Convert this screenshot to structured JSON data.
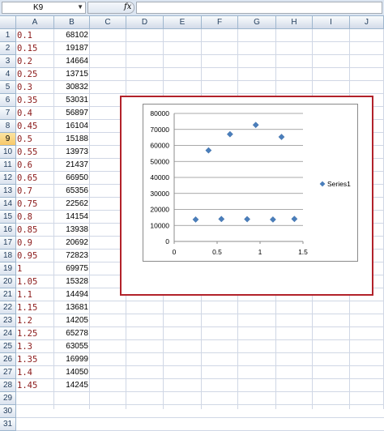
{
  "formula_bar": {
    "name_box": "K9",
    "fx_label": "fx",
    "formula": ""
  },
  "columns": [
    "A",
    "B",
    "C",
    "D",
    "E",
    "F",
    "G",
    "H",
    "I",
    "J"
  ],
  "active_row": 9,
  "rows": [
    {
      "num": "1",
      "a": "0.1",
      "b": "68102"
    },
    {
      "num": "2",
      "a": "0.15",
      "b": "19187"
    },
    {
      "num": "3",
      "a": "0.2",
      "b": "14664"
    },
    {
      "num": "4",
      "a": "0.25",
      "b": "13715"
    },
    {
      "num": "5",
      "a": "0.3",
      "b": "30832"
    },
    {
      "num": "6",
      "a": "0.35",
      "b": "53031"
    },
    {
      "num": "7",
      "a": "0.4",
      "b": "56897"
    },
    {
      "num": "8",
      "a": "0.45",
      "b": "16104"
    },
    {
      "num": "9",
      "a": "0.5",
      "b": "15188"
    },
    {
      "num": "10",
      "a": "0.55",
      "b": "13973"
    },
    {
      "num": "11",
      "a": "0.6",
      "b": "21437"
    },
    {
      "num": "12",
      "a": "0.65",
      "b": "66950"
    },
    {
      "num": "13",
      "a": "0.7",
      "b": "65356"
    },
    {
      "num": "14",
      "a": "0.75",
      "b": "22562"
    },
    {
      "num": "15",
      "a": "0.8",
      "b": "14154"
    },
    {
      "num": "16",
      "a": "0.85",
      "b": "13938"
    },
    {
      "num": "17",
      "a": "0.9",
      "b": "20692"
    },
    {
      "num": "18",
      "a": "0.95",
      "b": "72823"
    },
    {
      "num": "19",
      "a": "1",
      "b": "69975"
    },
    {
      "num": "20",
      "a": "1.05",
      "b": "15328"
    },
    {
      "num": "21",
      "a": "1.1",
      "b": "14494"
    },
    {
      "num": "22",
      "a": "1.15",
      "b": "13681"
    },
    {
      "num": "23",
      "a": "1.2",
      "b": "14205"
    },
    {
      "num": "24",
      "a": "1.25",
      "b": "65278"
    },
    {
      "num": "25",
      "a": "1.3",
      "b": "63055"
    },
    {
      "num": "26",
      "a": "1.35",
      "b": "16999"
    },
    {
      "num": "27",
      "a": "1.4",
      "b": "14050"
    },
    {
      "num": "28",
      "a": "1.45",
      "b": "14245"
    },
    {
      "num": "29",
      "a": "",
      "b": ""
    },
    {
      "num": "30",
      "a": "",
      "b": ""
    },
    {
      "num": "31",
      "a": "",
      "b": ""
    }
  ],
  "chart_data": {
    "type": "scatter",
    "marker_color": "#4a7ebb",
    "xlim": [
      0,
      1.5
    ],
    "ylim": [
      0,
      80000
    ],
    "x_ticks": [
      "0",
      "0.5",
      "1",
      "1.5"
    ],
    "y_ticks": [
      "0",
      "10000",
      "20000",
      "30000",
      "40000",
      "50000",
      "60000",
      "70000",
      "80000"
    ],
    "grid": "horizontal",
    "legend_position": "right",
    "series": [
      {
        "name": "Series1",
        "points": [
          [
            0.25,
            13700
          ],
          [
            0.4,
            56900
          ],
          [
            0.55,
            14000
          ],
          [
            0.65,
            67000
          ],
          [
            0.85,
            13900
          ],
          [
            0.95,
            72800
          ],
          [
            1.15,
            13700
          ],
          [
            1.25,
            65300
          ],
          [
            1.4,
            14050
          ]
        ]
      }
    ]
  }
}
